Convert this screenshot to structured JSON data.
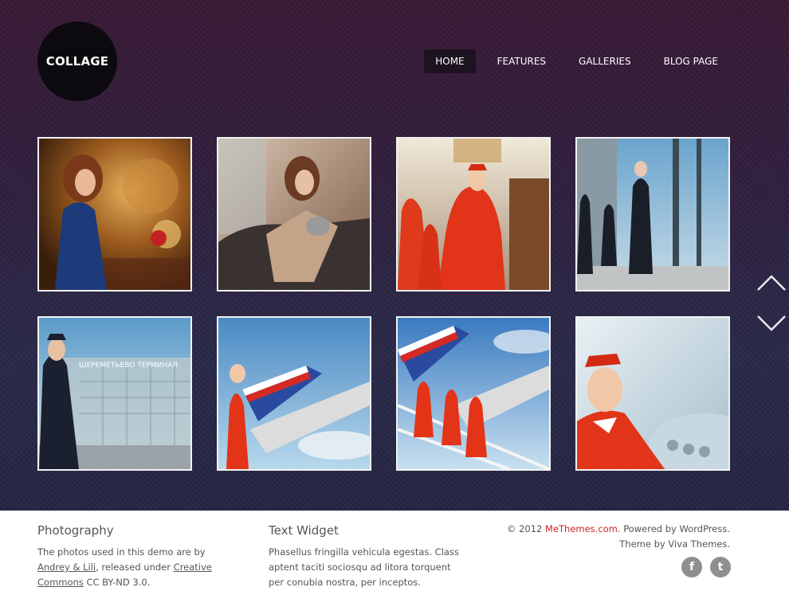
{
  "site": {
    "logo_text": "COLLAGE"
  },
  "nav": {
    "items": [
      {
        "label": "HOME",
        "active": true
      },
      {
        "label": "FEATURES",
        "active": false
      },
      {
        "label": "GALLERIES",
        "active": false
      },
      {
        "label": "BLOG PAGE",
        "active": false
      }
    ]
  },
  "gallery": {
    "thumbnails": [
      {
        "subject": "woman in blue dress at golden interior"
      },
      {
        "subject": "woman with cat on leather sofa"
      },
      {
        "subject": "flight attendants in red uniforms in hall"
      },
      {
        "subject": "flight attendants in dark uniforms by window"
      },
      {
        "subject": "attendant at airport terminal window",
        "sign_text": "ШЕРЕМЕТЬЕВО ТЕРМИНАЛ"
      },
      {
        "subject": "attendant under airplane tail"
      },
      {
        "subject": "attendants on airstairs under tail"
      },
      {
        "subject": "attendant smiling near plane fuselage"
      }
    ],
    "up_arrow_icon": "chevron-up-icon",
    "down_arrow_icon": "chevron-down-icon"
  },
  "footer": {
    "photography": {
      "title": "Photography",
      "text_before": "The photos used in this demo are by ",
      "author_link": "Andrey & Lili",
      "text_middle": ", released under ",
      "license_link": "Creative Commons",
      "text_after": " CC BY-ND 3.0."
    },
    "text_widget": {
      "title": "Text Widget",
      "text": "Phasellus fringilla vehicula egestas. Class aptent taciti sociosqu ad litora torquent per conubia nostra, per inceptos."
    },
    "credits": {
      "copyright_prefix": "© 2012 ",
      "brand": "MeThemes.com",
      "powered": ". Powered by WordPress.",
      "theme": "Theme by Viva Themes."
    },
    "social": [
      {
        "icon": "facebook-icon",
        "glyph": "f"
      },
      {
        "icon": "twitter-icon",
        "glyph": "t"
      }
    ]
  },
  "colors": {
    "accent": "#cc2222",
    "nav_active_bg": "#1c1220",
    "hero_top": "#3a1a36",
    "hero_bottom": "#262646"
  }
}
